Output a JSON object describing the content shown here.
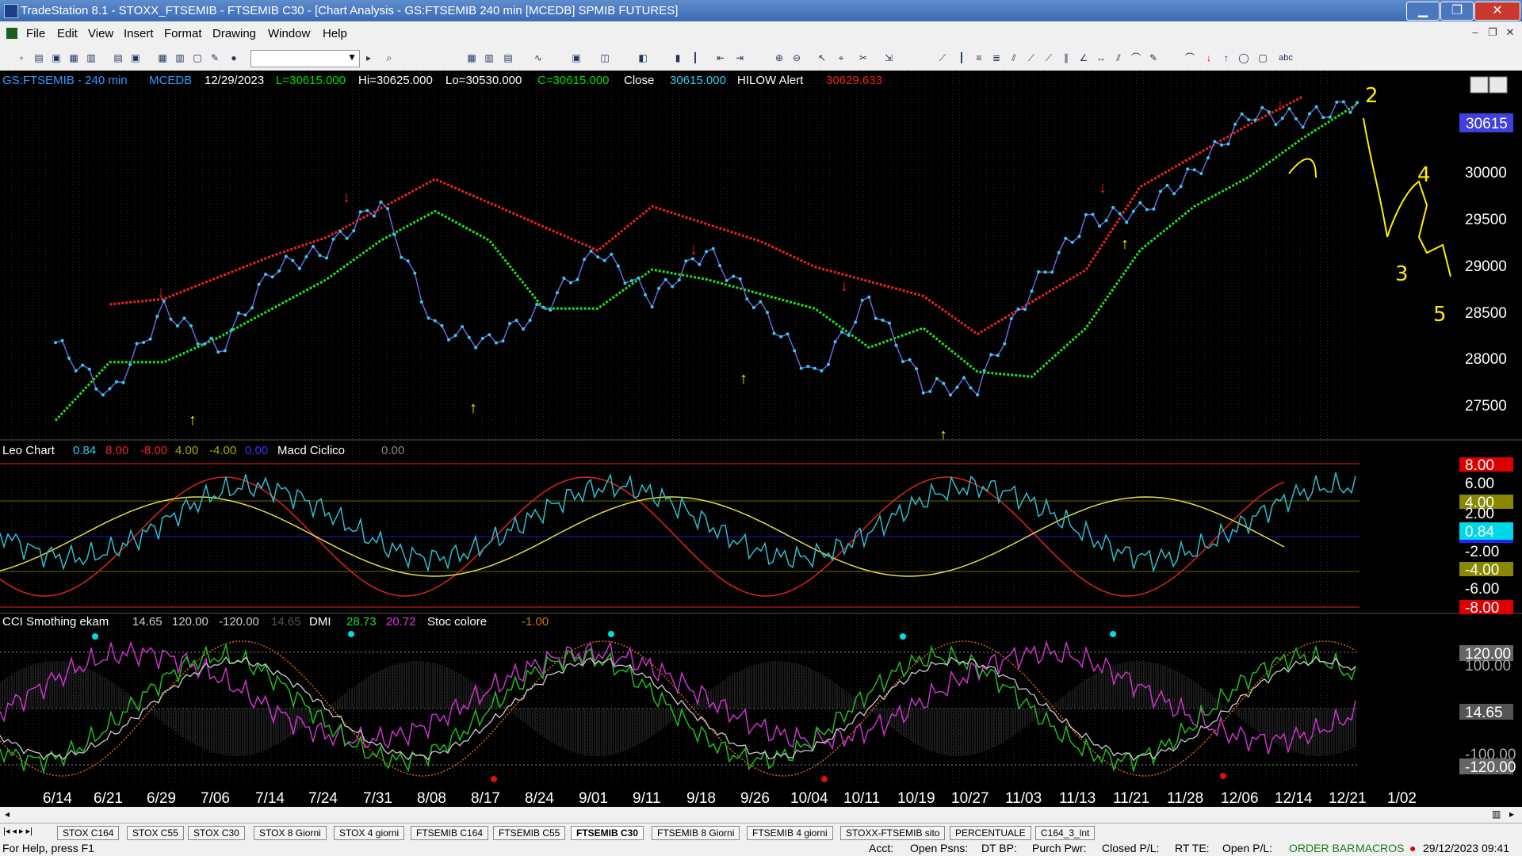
{
  "window": {
    "title": "TradeStation 8.1 - STOXX_FTSEMIB - FTSEMIB C30 - [Chart Analysis - GS:FTSEMIB  240 min  [MCEDB] SPMIB FUTURES]",
    "minimize": "▁",
    "restore": "❐",
    "close": "✕"
  },
  "menu": [
    "File",
    "Edit",
    "View",
    "Insert",
    "Format",
    "Drawing",
    "Window",
    "Help"
  ],
  "price_header": {
    "symbol": "GS:FTSEMIB - 240 min",
    "source": "MCEDB",
    "date": "12/29/2023",
    "low_last": "L=30615.000",
    "hi": "Hi=30625.000",
    "lo": "Lo=30530.000",
    "close_eq": "C=30615.000",
    "close_lbl": "Close",
    "close_val": "30615.000",
    "alert_lbl": "HILOW Alert",
    "alert_val": "30629.633"
  },
  "price_axis": [
    "30500",
    "30000",
    "29500",
    "29000",
    "28500",
    "28000",
    "27500"
  ],
  "price_tag": "30615",
  "leo_header": {
    "name": "Leo Chart",
    "v1": "0.84",
    "v2": "8.00",
    "v3": "-8.00",
    "v4": "4.00",
    "v5": "-4.00",
    "v6": "0.00",
    "name2": "Macd Ciclico",
    "v7": "0.00"
  },
  "leo_axis": [
    "8.00",
    "6.00",
    "4.00",
    "2.00",
    "0.84",
    "-2.00",
    "-4.00",
    "-6.00",
    "-8.00"
  ],
  "cci_header": {
    "name": "CCI Smothing ekam",
    "v1": "14.65",
    "v2": "120.00",
    "v3": "-120.00",
    "v4": "14.65",
    "dmi": "DMI",
    "d1": "28.73",
    "d2": "20.72",
    "stoc": "Stoc colore",
    "s1": "-1.00"
  },
  "cci_axis": [
    "120.00",
    "100.00",
    "14.65",
    "-100.00",
    "-120.00"
  ],
  "date_axis": [
    "6/14",
    "6/21",
    "6/29",
    "7/06",
    "7/14",
    "7/24",
    "7/31",
    "8/08",
    "8/17",
    "8/24",
    "9/01",
    "9/11",
    "9/18",
    "9/26",
    "10/04",
    "10/11",
    "10/19",
    "10/27",
    "11/03",
    "11/13",
    "11/21",
    "11/28",
    "12/06",
    "12/14",
    "12/21",
    "1/02"
  ],
  "annotations": [
    "2",
    "3",
    "4",
    "5"
  ],
  "tabs": [
    "STOX C164",
    "STOX C55",
    "STOX  C30",
    "STOX  8 Giorni",
    "STOX 4 giorni",
    "FTSEMIB C164",
    "FTSEMIB C55",
    "FTSEMIB C30",
    "FTSEMIB  8 Giorni",
    "FTSEMIB  4 giorni",
    "STOXX-FTSEMIB sito",
    "PERCENTUALE",
    "C164_3_lnt"
  ],
  "active_tab": "FTSEMIB C30",
  "status": {
    "help": "For Help, press F1",
    "acct": "Acct:",
    "open_psns": "Open Psns:",
    "dt_bp": "DT BP:",
    "purch": "Purch Pwr:",
    "closed_pl": "Closed P/L:",
    "rt_te": "RT TE:",
    "open_pl": "Open P/L:",
    "order": "ORDER BAR",
    "macros": "MACROS",
    "datetime": "29/12/2023 09:41"
  },
  "colors": {
    "price": "#33ccee",
    "down": "#ee2222",
    "up": "#22dd22",
    "arrow_up": "#ffee00"
  },
  "chart_data": {
    "type": "line",
    "xlabel": "",
    "ylabel": "",
    "ylim": [
      27200,
      30700
    ],
    "x": [
      "6/14",
      "6/21",
      "6/29",
      "7/06",
      "7/14",
      "7/24",
      "7/31",
      "8/08",
      "8/17",
      "8/24",
      "9/01",
      "9/11",
      "9/18",
      "9/26",
      "10/04",
      "10/11",
      "10/19",
      "10/27",
      "11/03",
      "11/13",
      "11/21",
      "11/28",
      "12/06",
      "12/14",
      "12/21"
    ],
    "series": [
      {
        "values": [
          28150,
          27600,
          28500,
          28050,
          28900,
          29100,
          29600,
          28300,
          28150,
          28500,
          29100,
          28600,
          29100,
          28500,
          27800,
          28600,
          27700,
          27700,
          28700,
          29400,
          29500,
          29900,
          30500,
          30450,
          30615
        ]
      },
      {
        "values": [
          27350,
          27950,
          27950,
          28200,
          28500,
          28800,
          29200,
          29500,
          29200,
          28500,
          28500,
          28900,
          28800,
          28650,
          28500,
          28100,
          28300,
          27850,
          27800,
          28300,
          29100,
          29550,
          29850,
          30250,
          30600
        ]
      }
    ]
  }
}
